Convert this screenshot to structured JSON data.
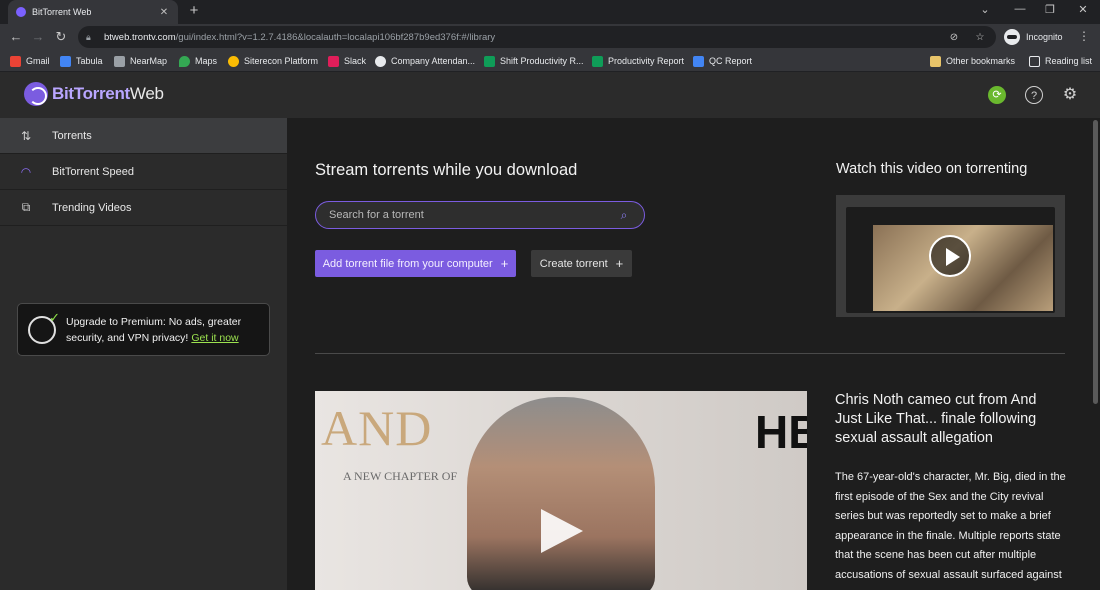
{
  "browser": {
    "tab_title": "BitTorrent Web",
    "tab_close": "✕",
    "new_tab": "+",
    "url_host": "btweb.trontv.com",
    "url_path": "/gui/index.html?v=1.2.7.4186&localauth=localapi106bf287b9ed376f:#/library",
    "incognito_label": "Incognito"
  },
  "bookmarks": [
    {
      "label": "Gmail",
      "color": "#ea4335"
    },
    {
      "label": "Tabula",
      "color": "#4285f4"
    },
    {
      "label": "NearMap",
      "color": "#9aa0a6"
    },
    {
      "label": "Maps",
      "color": "#34a853"
    },
    {
      "label": "Siterecon Platform",
      "color": "#fbbc04"
    },
    {
      "label": "Slack",
      "color": "#e01e5a"
    },
    {
      "label": "Company Attendan...",
      "color": "#e8eaed"
    },
    {
      "label": "Shift Productivity R...",
      "color": "#0f9d58"
    },
    {
      "label": "Productivity Report",
      "color": "#0f9d58"
    },
    {
      "label": "QC Report",
      "color": "#4285f4"
    }
  ],
  "other_bookmarks": "Other bookmarks",
  "reading_list": "Reading list",
  "app": {
    "logo_bold": "BitTorrent",
    "logo_light": "Web"
  },
  "sidebar": {
    "items": [
      {
        "label": "Torrents",
        "icon": "arrows-updown-icon"
      },
      {
        "label": "BitTorrent Speed",
        "icon": "speed-gauge-icon"
      },
      {
        "label": "Trending Videos",
        "icon": "play-video-icon"
      }
    ],
    "promo_text": "Upgrade to Premium: No ads, greater security, and VPN privacy!",
    "promo_link": "Get it now"
  },
  "main": {
    "stream_title": "Stream torrents while you download",
    "search_placeholder": "Search for a torrent",
    "add_button": "Add torrent file from your computer",
    "create_button": "Create torrent",
    "video_title": "Watch this video on torrenting",
    "news_headline": "Chris Noth cameo cut from And Just Like That... finale following sexual assault allegation",
    "news_body": "The 67-year-old's character, Mr. Big, died in the first episode of the Sex and the City revival series but was reportedly set to make a brief appearance in the finale. Multiple reports state that the scene has been cut after multiple accusations of sexual assault surfaced against",
    "news_image_text": "AND",
    "news_image_subtext": "A NEW CHAPTER OF",
    "news_image_logo": "HB"
  },
  "colors": {
    "accent": "#7b5ce0",
    "promo_link": "#9ce34f",
    "sidebar_bg": "#2b2b2b",
    "main_bg": "#1e1e1e"
  }
}
